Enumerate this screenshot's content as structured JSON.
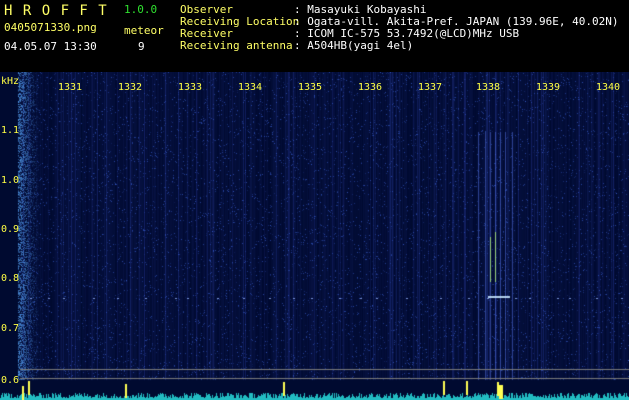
{
  "app": {
    "name": "H R O F F T",
    "version": "1.0.0"
  },
  "file": {
    "name": "0405071330.png",
    "datetime": "04.05.07 13:30"
  },
  "counter": {
    "label": "meteor",
    "value": "9"
  },
  "info": [
    {
      "label": "Observer",
      "value": ": Masayuki Kobayashi"
    },
    {
      "label": "Receiving Location",
      "value": ": Ogata-vill. Akita-Pref. JAPAN (139.96E, 40.02N)"
    },
    {
      "label": "Receiver",
      "value": ": ICOM IC-575 53.7492(@LCD)MHz USB"
    },
    {
      "label": "Receiving antenna",
      "value": ": A504HB(yagi 4el)"
    }
  ],
  "axis": {
    "unit": "kHz",
    "y_ticks": [
      "1.1",
      "1.0",
      "0.9",
      "0.8",
      "0.7",
      "0.6"
    ],
    "x_ticks": [
      "1331",
      "1332",
      "1333",
      "1334",
      "1335",
      "1336",
      "1337",
      "1338",
      "1339",
      "1340"
    ]
  },
  "colors": {
    "background": "#000000",
    "header_label": "#ffff66",
    "header_value": "#ffffff",
    "version": "#2fe02f",
    "spectrogram_bg": "#000a30",
    "axis_text": "#ffff44"
  }
}
